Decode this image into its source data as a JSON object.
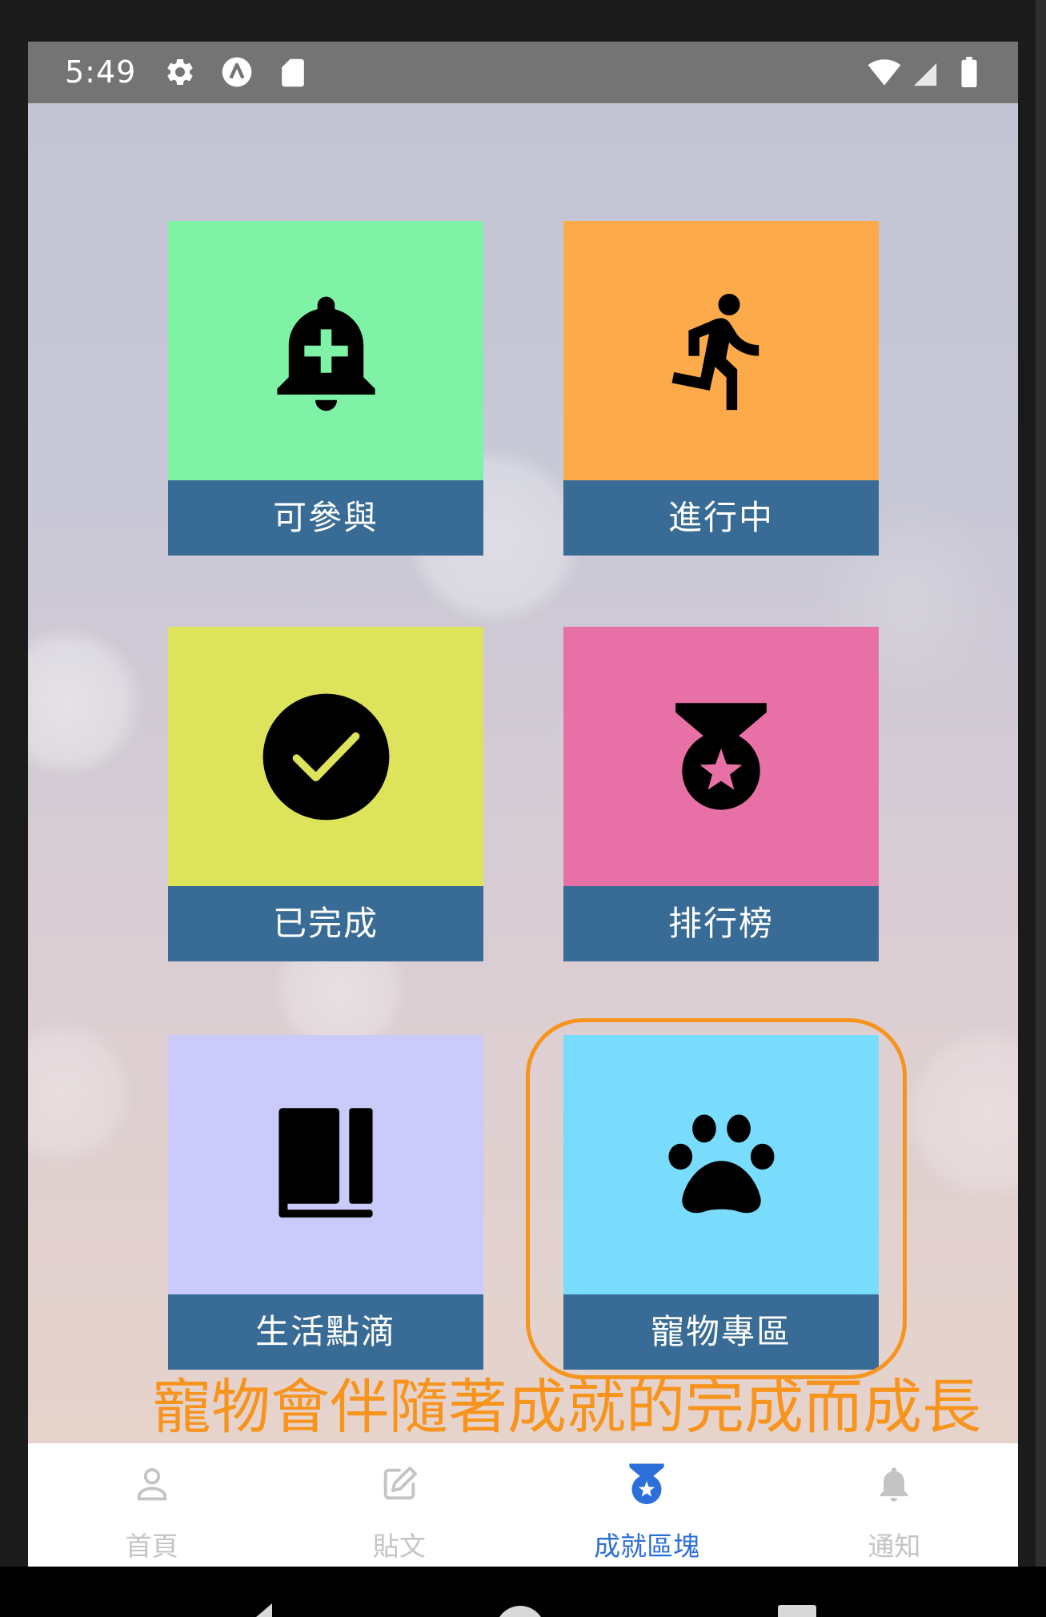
{
  "status_bar": {
    "time": "5:49",
    "background": "#747474",
    "left_icons": [
      "settings-icon",
      "a-circle-icon",
      "sd-card-icon"
    ],
    "right_icons": [
      "wifi-icon",
      "signal-icon",
      "battery-icon"
    ]
  },
  "tile_label_background": "#386b95",
  "tiles": [
    {
      "label": "可參與",
      "color": "#7ef3a6",
      "icon": "bell-plus-icon"
    },
    {
      "label": "進行中",
      "color": "#fdab4a",
      "icon": "running-icon"
    },
    {
      "label": "已完成",
      "color": "#dee35c",
      "icon": "check-circle-icon"
    },
    {
      "label": "排行榜",
      "color": "#e771a6",
      "icon": "medal-icon"
    },
    {
      "label": "生活點滴",
      "color": "#cbcbfb",
      "icon": "book-icon"
    },
    {
      "label": "寵物專區",
      "color": "#79dcfd",
      "icon": "paw-icon"
    }
  ],
  "highlight": {
    "color": "#f7941d"
  },
  "annotation": {
    "text": "寵物會伴隨著成就的完成而成長",
    "color": "#f7941d"
  },
  "bottom_nav": {
    "active_color": "#2d6fd8",
    "inactive_color": "#c4c4c4",
    "items": [
      {
        "label": "首頁",
        "icon": "person-icon",
        "active": false
      },
      {
        "label": "貼文",
        "icon": "edit-icon",
        "active": false
      },
      {
        "label": "成就區塊",
        "icon": "medal-icon",
        "active": true
      },
      {
        "label": "通知",
        "icon": "bell-icon",
        "active": false
      }
    ]
  },
  "system_nav": {
    "icons": [
      "back-icon",
      "home-icon",
      "recents-icon"
    ]
  }
}
